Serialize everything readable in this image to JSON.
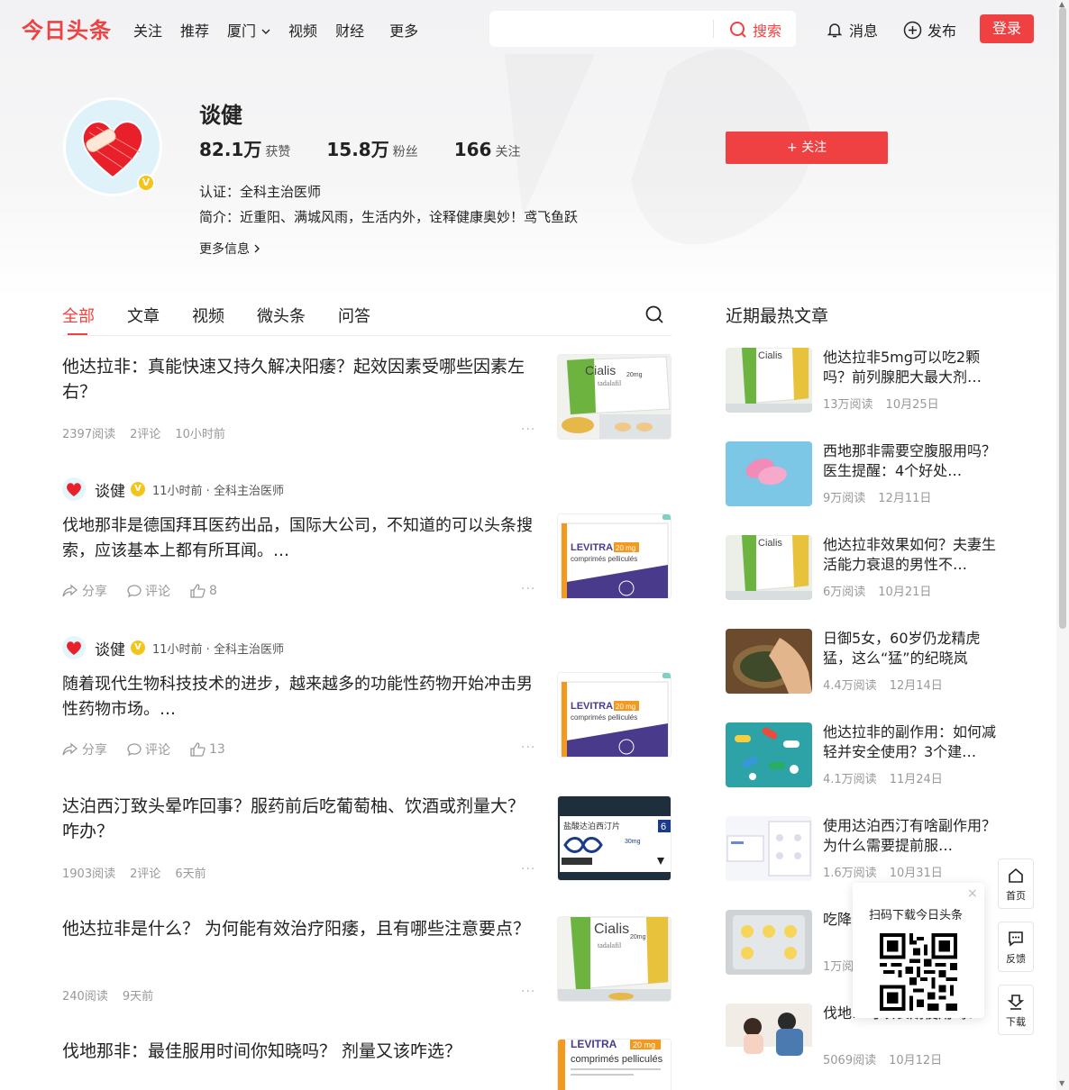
{
  "header": {
    "logo": "今日头条",
    "nav": [
      "关注",
      "推荐",
      "厦门",
      "视频",
      "财经",
      "更多"
    ],
    "search_placeholder": "",
    "search_label": "搜索",
    "messages_label": "消息",
    "publish_label": "发布",
    "login_label": "登录"
  },
  "profile": {
    "name": "谈健",
    "likes_num": "82.1万",
    "likes_label": "获赞",
    "fans_num": "15.8万",
    "fans_label": "粉丝",
    "following_num": "166",
    "following_label": "关注",
    "certification": "认证：全科主治医师",
    "intro": "简介：近重阳、满城风雨，生活内外，诠释健康奥妙！鸢飞鱼跃",
    "more_info": "更多信息",
    "follow_label": "+ 关注",
    "badge": "V"
  },
  "tabs": [
    "全部",
    "文章",
    "视频",
    "微头条",
    "问答"
  ],
  "feed": [
    {
      "type": "article",
      "title": "他达拉非：真能快速又持久解决阳痿？起效因素受哪些因素左右？",
      "reads": "2397阅读",
      "comments": "2评论",
      "time": "10小时前"
    },
    {
      "type": "micro",
      "author": "谈健",
      "author_meta": "11小时前 · 全科主治医师",
      "text": "伐地那非是德国拜耳医药出品，国际大公司，不知道的可以头条搜索，应该基本上都有所耳闻。…",
      "share": "分享",
      "comment": "评论",
      "likes": "8"
    },
    {
      "type": "micro",
      "author": "谈健",
      "author_meta": "11小时前 · 全科主治医师",
      "text": "随着现代生物科技技术的进步，越来越多的功能性药物开始冲击男性药物市场。…",
      "share": "分享",
      "comment": "评论",
      "likes": "13"
    },
    {
      "type": "article",
      "title": "达泊西汀致头晕咋回事？服药前后吃葡萄柚、饮酒或剂量大？ 咋办？",
      "reads": "1903阅读",
      "comments": "2评论",
      "time": "6天前"
    },
    {
      "type": "article",
      "title": "他达拉非是什么？ 为何能有效治疗阳痿，且有哪些注意要点？",
      "reads": "240阅读",
      "time": "9天前"
    },
    {
      "type": "article",
      "title": "伐地那非：最佳服用时间你知晓吗？ 剂量又该咋选？"
    }
  ],
  "thumb_labels": {
    "cialis": "Cialis",
    "cialis_dose": "20mg",
    "cialis_sub": "tadalafil",
    "levitra": "LEVITRA",
    "levitra_dose": "20 mg",
    "levitra_sub": "comprimés pelliculés",
    "dapox_cn": "盐酸达泊西汀片",
    "dapox_dose": "30mg",
    "dapox_num": "6"
  },
  "side": {
    "title": "近期最热文章",
    "items": [
      {
        "title": "他达拉非5mg可以吃2颗吗？前列腺肥大最大剂…",
        "reads": "13万阅读",
        "date": "10月25日"
      },
      {
        "title": "西地那非需要空腹服用吗？医生提醒：4个好处…",
        "reads": "9万阅读",
        "date": "12月11日"
      },
      {
        "title": "他达拉非效果如何？夫妻生活能力衰退的男性不…",
        "reads": "6万阅读",
        "date": "10月21日"
      },
      {
        "title": "日御5女，60岁仍龙精虎猛，这么“猛”的纪晓岚有…",
        "reads": "4.4万阅读",
        "date": "12月14日"
      },
      {
        "title": "他达拉非的副作用：如何减轻并安全使用？3个建…",
        "reads": "4.1万阅读",
        "date": "11月24日"
      },
      {
        "title": "使用达泊西汀有啥副作用？为什么需要提前服…",
        "reads": "1.6万阅读",
        "date": "10月31日"
      },
      {
        "title": "吃降…吗？",
        "reads": "1万阅…",
        "date": ""
      },
      {
        "title": "伐地…可以长期使用吗？",
        "reads": "5069阅读",
        "date": "10月12日"
      }
    ]
  },
  "qr": {
    "text": "扫码下载今日头条",
    "close": "×"
  },
  "tools": [
    {
      "label": "首页"
    },
    {
      "label": "反馈"
    },
    {
      "label": "下载"
    }
  ],
  "colors": {
    "brand": "#f04142",
    "badge": "#f5c41b",
    "meta": "#999999"
  }
}
